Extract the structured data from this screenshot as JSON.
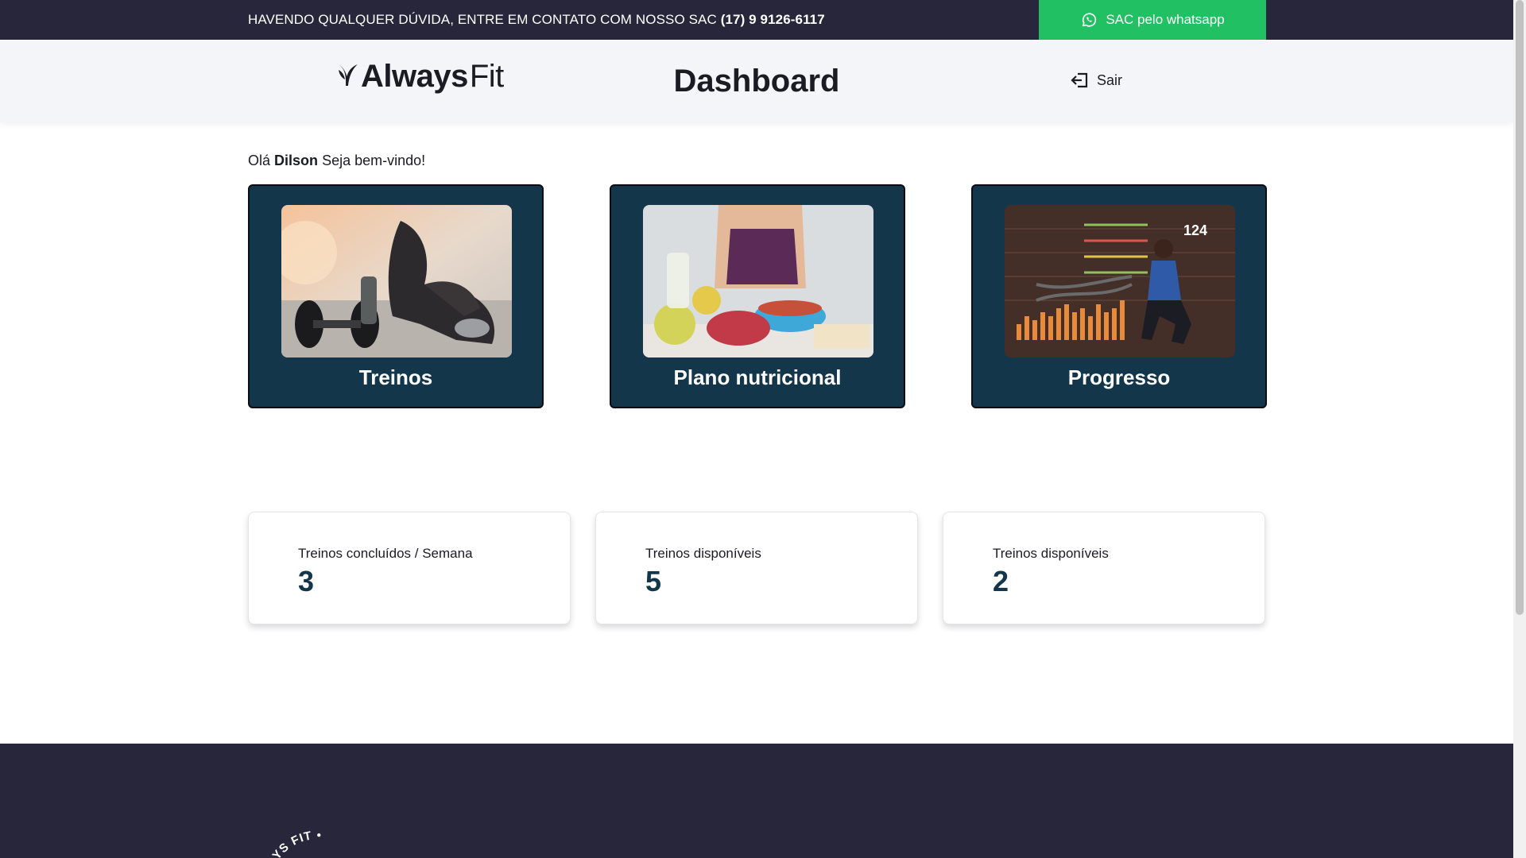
{
  "topbar": {
    "sac_prefix": "HAVENDO QUALQUER DÚVIDA, ENTRE EM CONTATO COM NOSSO SAC",
    "sac_phone": "(17) 9 9126-6117",
    "whatsapp_label": "SAC pelo whatsapp",
    "whatsapp_icon": "whatsapp-icon",
    "whatsapp_color": "#21c063",
    "bg_color": "#27263a"
  },
  "header": {
    "logo_bold": "Always",
    "logo_light": "Fit",
    "logo_icon": "leaf-icon",
    "title": "Dashboard",
    "logout_label": "Sair",
    "logout_icon": "logout-icon"
  },
  "greeting": {
    "prefix": "Olá",
    "name": "Dilson",
    "suffix": "Seja bem-vindo!"
  },
  "cards": [
    {
      "label": "Treinos",
      "image": "workout-dumbbells-photo"
    },
    {
      "label": "Plano nutricional",
      "image": "nutrition-fruits-photo"
    },
    {
      "label": "Progresso",
      "image": "progress-battle-ropes-photo",
      "overlay_number": "124"
    }
  ],
  "card_color": "#14364a",
  "stats": [
    {
      "label": "Treinos concluídos / Semana",
      "value": "3"
    },
    {
      "label": "Treinos disponíveis",
      "value": "5"
    },
    {
      "label": "Treinos disponíveis",
      "value": "2"
    }
  ],
  "footer": {
    "seal_text": "WAYS FIT •",
    "bg_color": "#27263a"
  }
}
